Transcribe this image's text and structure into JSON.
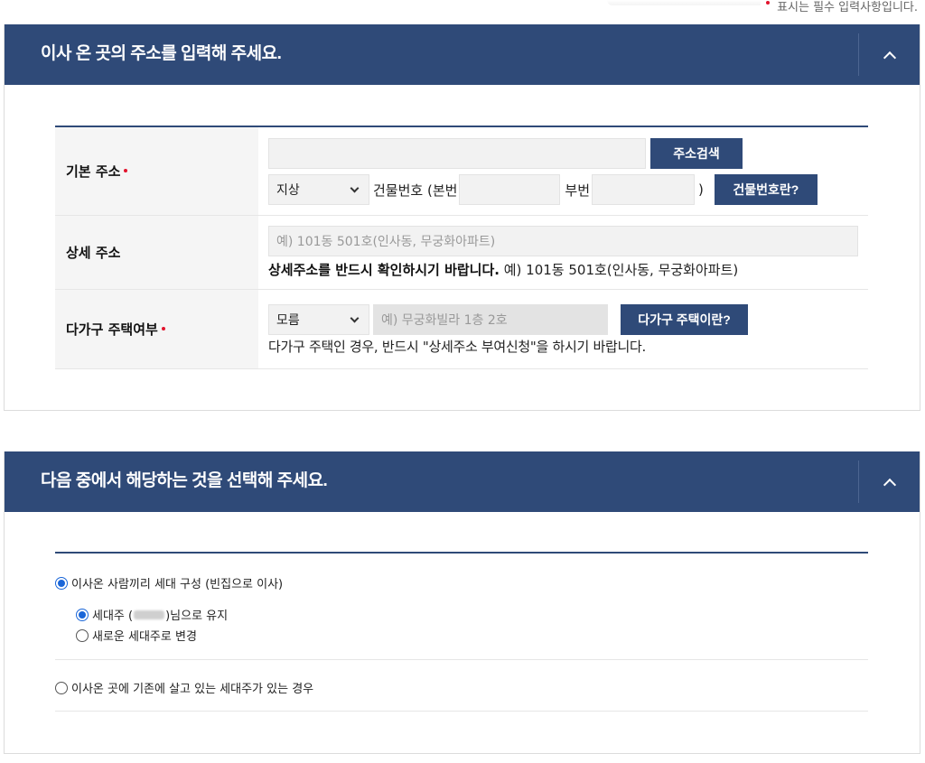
{
  "required_note": "표시는 필수 입력사항입니다.",
  "section1": {
    "title": "이사 온 곳의 주소를 입력해 주세요.",
    "basic_address": {
      "label": "기본 주소",
      "search_button": "주소검색",
      "ground_select": "지상",
      "building_no_label": "건물번호 (본번",
      "sub_no_label": "부번",
      "close_paren": ")",
      "building_no_button": "건물번호란?"
    },
    "detail_address": {
      "label": "상세 주소",
      "placeholder": "예) 101동 501호(인사동, 무궁화아파트)",
      "note_bold": "상세주소를 반드시 확인하시기 바랍니다.",
      "note_rest": " 예) 101동 501호(인사동, 무궁화아파트)"
    },
    "multi_house": {
      "label": "다가구 주택여부",
      "select_value": "모름",
      "placeholder": "예) 무궁화빌라 1층 2호",
      "button": "다가구 주택이란?",
      "note": "다가구 주택인 경우, 반드시 \"상세주소 부여신청\"을 하시기 바랍니다."
    }
  },
  "section2": {
    "title": "다음 중에서 해당하는 것을 선택해 주세요.",
    "option1": "이사온 사람끼리 세대 구성 (빈집으로 이사)",
    "sub1_prefix": "세대주 (",
    "sub1_suffix": ")님으로 유지",
    "sub2": "새로운 세대주로 변경",
    "option2": "이사온 곳에 기존에 살고 있는 세대주가 있는 경우"
  }
}
